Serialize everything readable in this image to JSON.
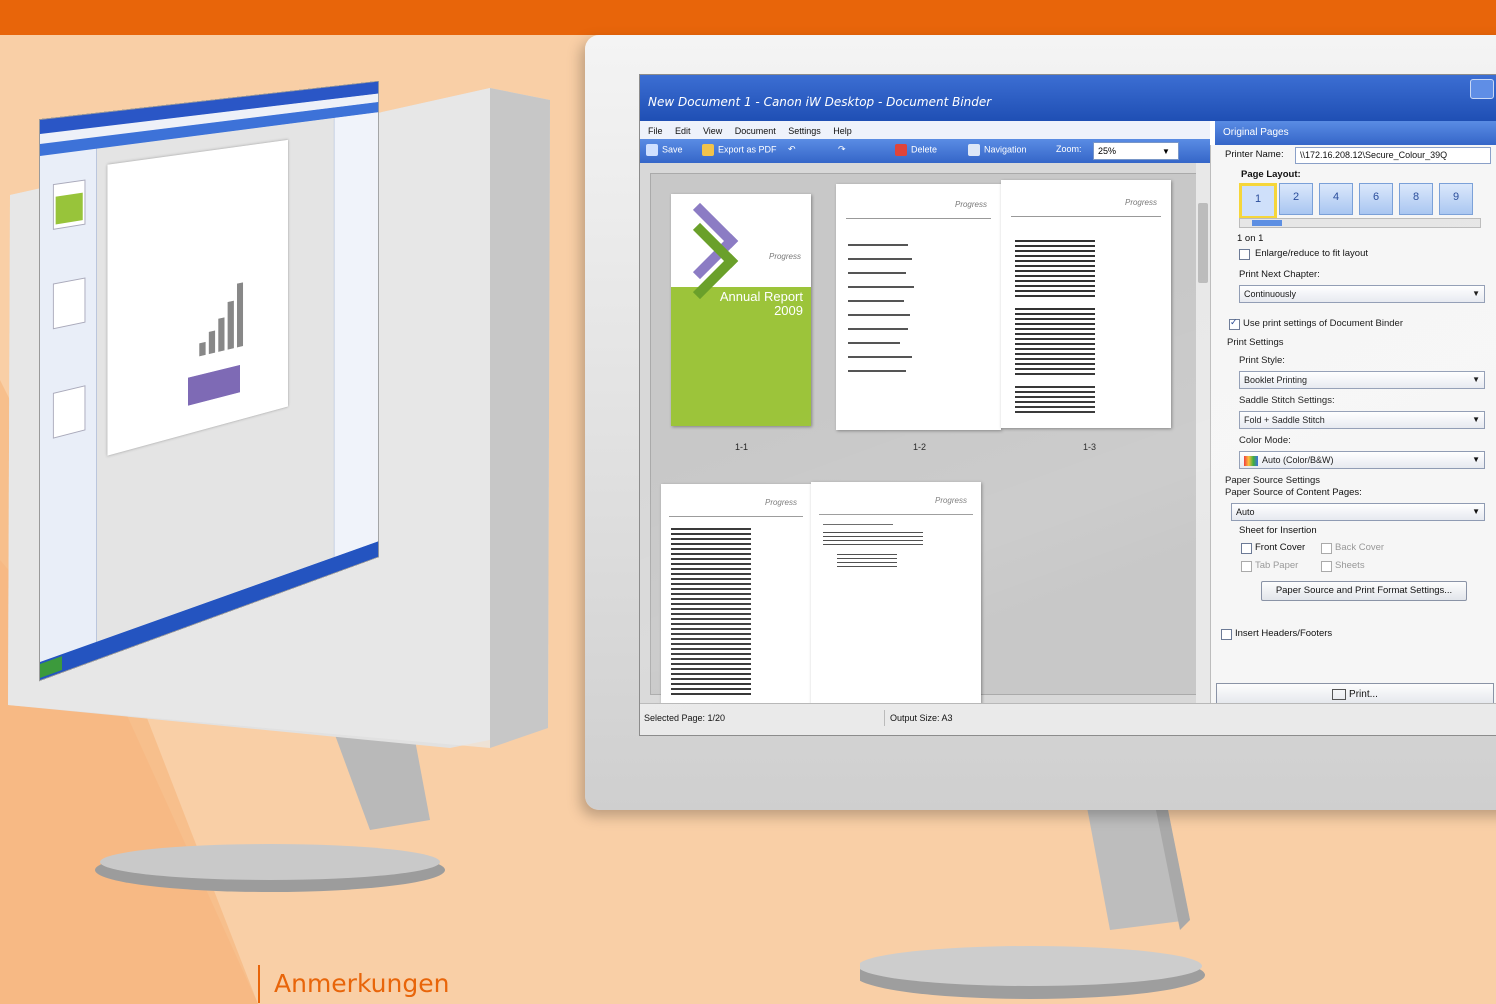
{
  "caption": "Anmerkungen",
  "colors": {
    "accent": "#e8650a",
    "background": "#f9cfa6",
    "cover_green": "#9cc43a",
    "cover_purple": "#8c7cc4",
    "title_blue": "#1f4fb4"
  },
  "right_app": {
    "title": "New Document 1 - Canon iW Desktop - Document Binder",
    "menu": [
      "File",
      "Edit",
      "View",
      "Document",
      "Settings",
      "Help"
    ],
    "toolbar": {
      "save": "Save",
      "export": "Export as PDF",
      "delete": "Delete",
      "navigation": "Navigation",
      "zoom_label": "Zoom:",
      "zoom_value": "25%"
    },
    "original_pages_tab": "Original Pages",
    "pages": {
      "labels": [
        "1-1",
        "1-2",
        "1-3"
      ],
      "cover_title": "Annual Report 2009",
      "logo": "Progress"
    },
    "panel": {
      "printer_label": "Printer Name:",
      "printer_value": "\\\\172.16.208.12\\Secure_Colour_39Q",
      "page_layout_label": "Page Layout:",
      "layout_buttons": [
        "1",
        "2",
        "4",
        "6",
        "8",
        "9"
      ],
      "layout_value": "1 on 1",
      "enlarge_label": "Enlarge/reduce to fit layout",
      "enlarge_checked": false,
      "next_chapter_label": "Print Next Chapter:",
      "next_chapter_value": "Continuously",
      "use_print_settings_label": "Use print settings of Document Binder",
      "use_print_settings_checked": true,
      "print_settings_header": "Print Settings",
      "print_style_label": "Print Style:",
      "print_style_value": "Booklet Printing",
      "saddle_label": "Saddle Stitch Settings:",
      "saddle_value": "Fold + Saddle Stitch",
      "color_mode_label": "Color Mode:",
      "color_mode_value": "Auto (Color/B&W)",
      "paper_source_header": "Paper Source Settings",
      "paper_source_content_label": "Paper Source of Content Pages:",
      "paper_source_value": "Auto",
      "sheet_insertion_label": "Sheet for Insertion",
      "front_cover": "Front Cover",
      "back_cover": "Back Cover",
      "tab_paper": "Tab Paper",
      "sheets": "Sheets",
      "paper_source_button": "Paper Source and Print Format Settings...",
      "insert_headers_label": "Insert Headers/Footers",
      "print_button": "Print..."
    },
    "status": {
      "selected_page": "Selected Page:  1/20",
      "output_size": "Output Size:  A3"
    }
  }
}
